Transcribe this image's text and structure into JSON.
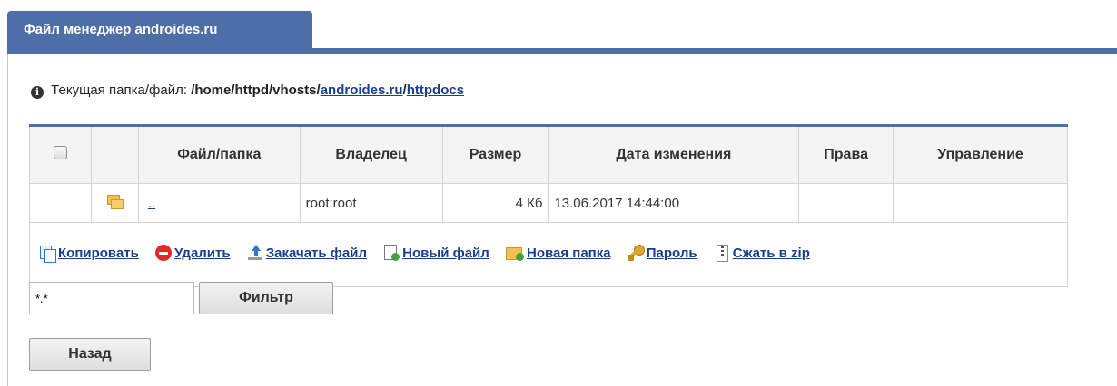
{
  "header": {
    "tab_title": "Файл менеджер androides.ru"
  },
  "path": {
    "label": "Текущая папка/файл:",
    "prefix": "/home/httpd/vhosts/",
    "link1": "androides.ru",
    "sep": "/",
    "link2": "httpdocs"
  },
  "table": {
    "headers": [
      "Файл/папка",
      "Владелец",
      "Размер",
      "Дата изменения",
      "Права",
      "Управление"
    ],
    "rows": [
      {
        "name": "..",
        "owner": "root:root",
        "size": "4 Кб",
        "modified": "13.06.2017 14:44:00",
        "perms": "",
        "manage": ""
      }
    ]
  },
  "actions": {
    "copy": "Копировать",
    "delete": "Удалить",
    "upload": "Закачать файл",
    "new_file": "Новый файл",
    "new_folder": "Новая папка",
    "password": "Пароль",
    "zip": "Сжать в zip"
  },
  "filter": {
    "value": "*.*",
    "button": "Фильтр"
  },
  "back_button": "Назад",
  "colors": {
    "accent": "#4e6ea8",
    "link": "#1a3f8a"
  }
}
